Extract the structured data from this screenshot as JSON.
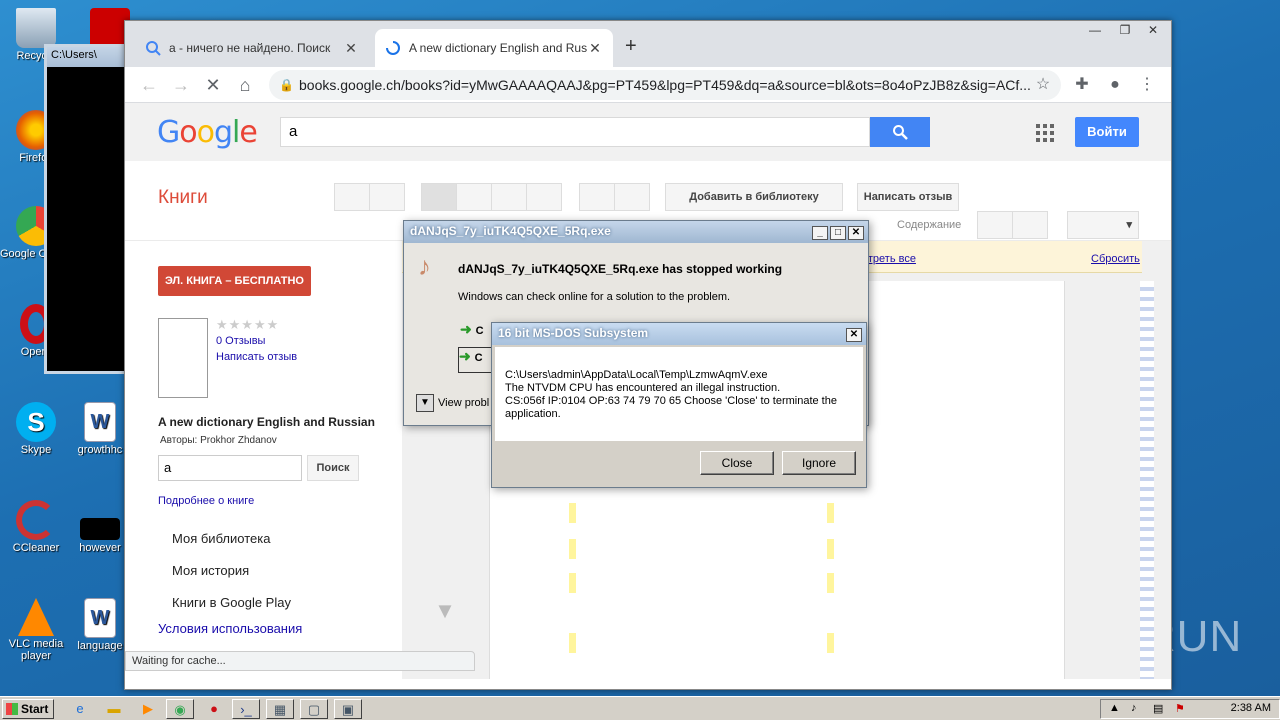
{
  "desktop": {
    "icons": [
      {
        "label": "Recycle",
        "color": "#9ab"
      },
      {
        "label": "Firefox",
        "color": "#e66000"
      },
      {
        "label": "Google Chrome",
        "color": "#34a853"
      },
      {
        "label": "Opera",
        "color": "#cc0f16"
      },
      {
        "label": "Skype",
        "color": "#00aff0"
      },
      {
        "label": "CCleaner",
        "color": "#c33"
      },
      {
        "label": "VLC media player",
        "color": "#f80"
      }
    ],
    "icons_col2": [
      {
        "label": "growthhc",
        "color": "#2b579a"
      },
      {
        "label": "however",
        "color": "#000"
      },
      {
        "label": "language",
        "color": "#2b579a"
      }
    ],
    "cmd_title": "C:\\Users\\"
  },
  "browser": {
    "tabs": [
      {
        "title": "a - ничего не найдено. Поиск",
        "close": "✕"
      },
      {
        "title": "A new dictionary English and Russian",
        "close": "✕"
      }
    ],
    "new_tab": "+",
    "url": "books.google.ch/books?id=yMwGAAAAQAAJ&pg=PT459&lpg=PT459&dq=a&source=bl&ots=8o4oPzJB8z&sig=ACf...",
    "status": "Waiting for cache..."
  },
  "google": {
    "search_value": "a",
    "signin": "Войти",
    "books_label": "Книги",
    "add_library": "Добавить в библиотеку",
    "write_review_btn": "Написать отзыв",
    "contents": "Содержание",
    "ebook_free": "ЭЛ. КНИГА – БЕСПЛАТНО",
    "stars": "★★★★★",
    "reviews": "0 Отзывы",
    "write_review": "Написать отзыв",
    "book_title": "A new dictionary English and Russian",
    "authors": "Авторы: Prokhor Zhdanov",
    "inbook_value": "a",
    "inbook_search": "Поиск",
    "more_about": "Подробнее о книге",
    "menu": [
      "Моя библиотека",
      "Моя история",
      "Книги в Google Play"
    ],
    "terms": "Условия использования",
    "show_all": "отреть все",
    "reset": "Сбросить"
  },
  "dialog_crash": {
    "title": "dANJqS_7y_iuTK4Q5QXE_5Rq.exe",
    "heading": "dANJqS_7y_iuTK4Q5QXE_5Rq.exe has stopped working",
    "subtext": "Windows can check online for a solution to the problem.",
    "option1": "C",
    "option2": "C",
    "view_problem": "View probl"
  },
  "dialog_dos": {
    "title": "16 bit MS-DOS Subsystem",
    "line1": "C:\\Users\\admin\\AppData\\Local\\Temp\\LzmwAqmV.exe",
    "line2": "The NTVDM CPU has encountered an illegal instruction.",
    "line3": "CS:056f IP:0104 OP:63 74 79 70 65 Choose 'Close' to terminate the",
    "line4": "application.",
    "close_btn": "Close",
    "ignore_btn": "Ignore"
  },
  "taskbar": {
    "start": "Start",
    "clock": "2:38 AM"
  },
  "watermark": "ANY RUN"
}
